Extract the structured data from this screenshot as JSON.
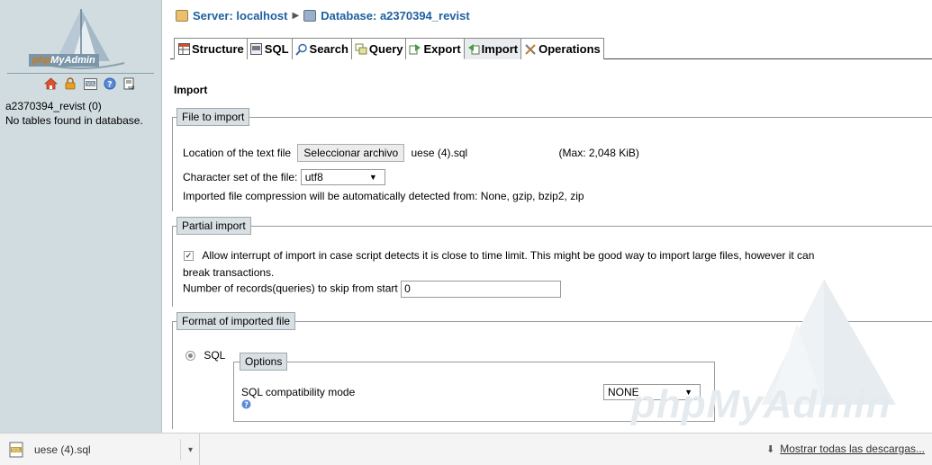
{
  "sidebar": {
    "logo_text_php": "php",
    "logo_text_rest": "MyAdmin",
    "icons": [
      "home-icon",
      "logout-icon",
      "sql-query-icon",
      "help-icon",
      "sql-docs-icon"
    ],
    "db_name": "a2370394_revist (0)",
    "no_tables": "No tables found in database."
  },
  "breadcrumb": {
    "server": "Server: localhost",
    "database": "Database: a2370394_revist"
  },
  "tabs": [
    {
      "label": "Structure",
      "icon": "structure-icon"
    },
    {
      "label": "SQL",
      "icon": "sql-icon"
    },
    {
      "label": "Search",
      "icon": "search-icon"
    },
    {
      "label": "Query",
      "icon": "query-icon"
    },
    {
      "label": "Export",
      "icon": "export-icon"
    },
    {
      "label": "Import",
      "icon": "import-icon"
    },
    {
      "label": "Operations",
      "icon": "operations-icon"
    }
  ],
  "page_heading": "Import",
  "file_to_import": {
    "legend": "File to import",
    "location_label": "Location of the text file",
    "choose_button": "Seleccionar archivo",
    "chosen_file": "uese (4).sql",
    "max_size": "(Max: 2,048 KiB)",
    "charset_label": "Character set of the file:",
    "charset_value": "utf8",
    "compression_note": "Imported file compression will be automatically detected from: None, gzip, bzip2, zip"
  },
  "partial_import": {
    "legend": "Partial import",
    "allow_interrupt_line1": "Allow interrupt of import in case script detects it is close to time limit. This might be good way to import large files, however it can",
    "allow_interrupt_line2": "break transactions.",
    "allow_interrupt_checked": true,
    "skip_label": "Number of records(queries) to skip from start",
    "skip_value": "0"
  },
  "format": {
    "legend": "Format of imported file",
    "sql_label": "SQL",
    "options_legend": "Options",
    "compat_label": "SQL compatibility mode",
    "compat_value": "NONE"
  },
  "watermark_text": "phpMyAdmin",
  "download_bar": {
    "file_name": "uese (4).sql",
    "show_all": "Mostrar todas las descargas..."
  },
  "colors": {
    "sidebar_bg": "#d0dce0",
    "breadcrumb": "#2060a0",
    "legend_bg": "#d8e0e4",
    "active_tab_bg": "#e8ecee"
  }
}
